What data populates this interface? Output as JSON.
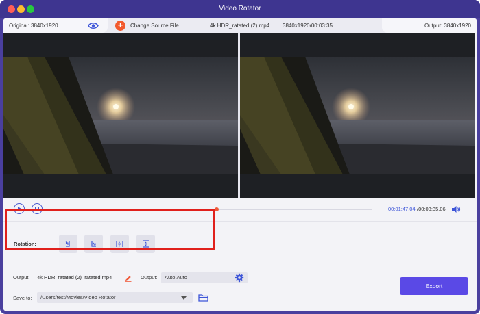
{
  "window": {
    "title": "Video Rotator"
  },
  "infobar": {
    "original_label": "Original: 3840x1920",
    "change_source_label": "Change Source File",
    "file_name": "4k HDR_ratated (2).mp4",
    "file_info": "3840x1920/00:03:35",
    "output_label": "Output: 3840x1920"
  },
  "playback": {
    "current_time": "00:01:47.04",
    "total_time": "/00:03:35.06",
    "progress": 0.5
  },
  "rotation": {
    "label": "Rotation:",
    "buttons": [
      {
        "icon": "rotate-left-icon"
      },
      {
        "icon": "rotate-right-icon"
      },
      {
        "icon": "flip-horizontal-icon"
      },
      {
        "icon": "flip-vertical-icon"
      }
    ]
  },
  "output": {
    "output_label": "Output:",
    "file_name": "4k HDR_ratated (2)_ratated.mp4",
    "format_label": "Output:",
    "format_value": "Auto;Auto",
    "save_to_label": "Save to:",
    "save_path": "/Users/test/Movies/Video Rotator",
    "export_label": "Export"
  },
  "colors": {
    "accent": "#5a49e6",
    "progress": "#f05a3a",
    "highlight_border": "#e0201c",
    "window_frame": "#4a3f9e"
  }
}
